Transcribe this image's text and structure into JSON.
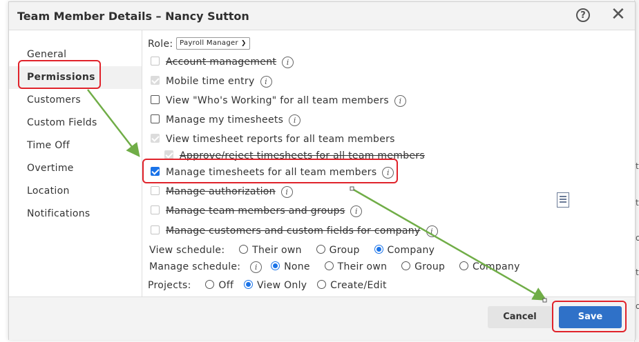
{
  "dialog": {
    "title": "Team Member Details – Nancy Sutton",
    "help_icon": "?",
    "close_icon": "✕"
  },
  "sidebar": {
    "items": [
      {
        "label": "General"
      },
      {
        "label": "Permissions",
        "active": true
      },
      {
        "label": "Customers"
      },
      {
        "label": "Custom Fields"
      },
      {
        "label": "Time Off"
      },
      {
        "label": "Overtime"
      },
      {
        "label": "Location"
      },
      {
        "label": "Notifications"
      }
    ]
  },
  "role": {
    "label": "Role:",
    "selected": "Payroll Manager"
  },
  "permissions": [
    {
      "label": "Account management",
      "state": "disabled",
      "strike": true,
      "info": true
    },
    {
      "label": "Mobile time entry",
      "state": "checked-disabled",
      "info": true
    },
    {
      "label": "View \"Who's Working\" for all team members",
      "state": "unchecked",
      "info": true
    },
    {
      "label": "Manage my timesheets",
      "state": "unchecked",
      "info": true
    },
    {
      "label": "View timesheet reports for all team members",
      "state": "checked-disabled",
      "info": false
    },
    {
      "label": "Approve/reject timesheets for all team members",
      "state": "checked-disabled",
      "strike": true,
      "info": false
    },
    {
      "label": "Manage timesheets for all team members",
      "state": "checked",
      "info": true
    },
    {
      "label": "Manage authorization",
      "state": "disabled",
      "strike": true,
      "info": true
    },
    {
      "label": "Manage team members and groups",
      "state": "disabled",
      "strike": true,
      "info": true
    },
    {
      "label": "Manage customers and custom fields for company",
      "state": "disabled",
      "strike": true,
      "info": true
    }
  ],
  "view_schedule": {
    "label": "View schedule:",
    "options": [
      "Their own",
      "Group",
      "Company"
    ],
    "selected": "Company"
  },
  "manage_schedule": {
    "label": "Manage schedule:",
    "options": [
      "None",
      "Their own",
      "Group",
      "Company"
    ],
    "selected": "None"
  },
  "projects": {
    "label": "Projects:",
    "options": [
      "Off",
      "View Only",
      "Create/Edit"
    ],
    "selected": "View Only"
  },
  "footer": {
    "cancel_label": "Cancel",
    "save_label": "Save"
  },
  "background_marks": [
    "t",
    "t",
    "o",
    "t",
    "o"
  ],
  "colors": {
    "accent": "#1a73e8",
    "save_button": "#2f71c8",
    "annotation_box": "#e0222a",
    "annotation_arrow": "#70ad47"
  }
}
